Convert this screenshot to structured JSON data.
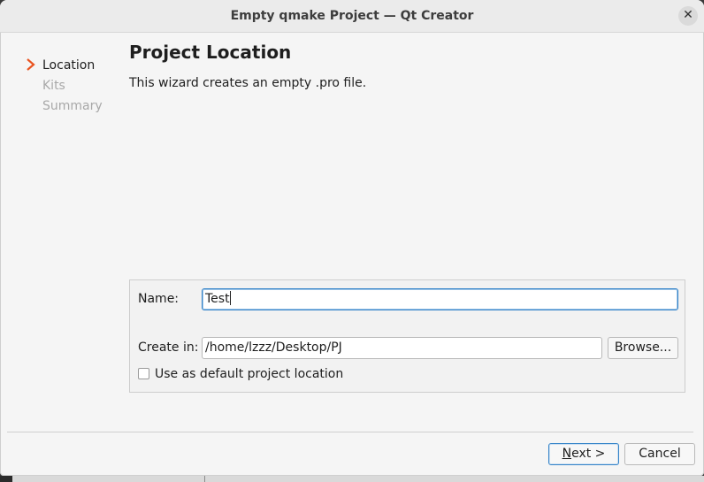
{
  "window": {
    "title": "Empty qmake Project — Qt Creator",
    "close_icon": "close-icon",
    "close_glyph": "✕"
  },
  "sidebar": {
    "steps": [
      {
        "label": "Location",
        "state": "current"
      },
      {
        "label": "Kits",
        "state": "pending"
      },
      {
        "label": "Summary",
        "state": "pending"
      }
    ],
    "current_marker_icon": "chevron-right-icon",
    "marker_color": "#e95420"
  },
  "page": {
    "title": "Project Location",
    "description": "This wizard creates an empty .pro file."
  },
  "form": {
    "name_label": "Name:",
    "name_value": "Test",
    "create_in_label": "Create in:",
    "create_in_value": "/home/lzzz/Desktop/PJ",
    "browse_label": "Browse...",
    "default_location_label": "Use as default project location",
    "default_location_checked": false
  },
  "footer": {
    "next_mnemonic": "N",
    "next_rest": "ext >",
    "cancel_label": "Cancel"
  },
  "colors": {
    "accent": "#3584c9",
    "marker": "#e95420"
  }
}
